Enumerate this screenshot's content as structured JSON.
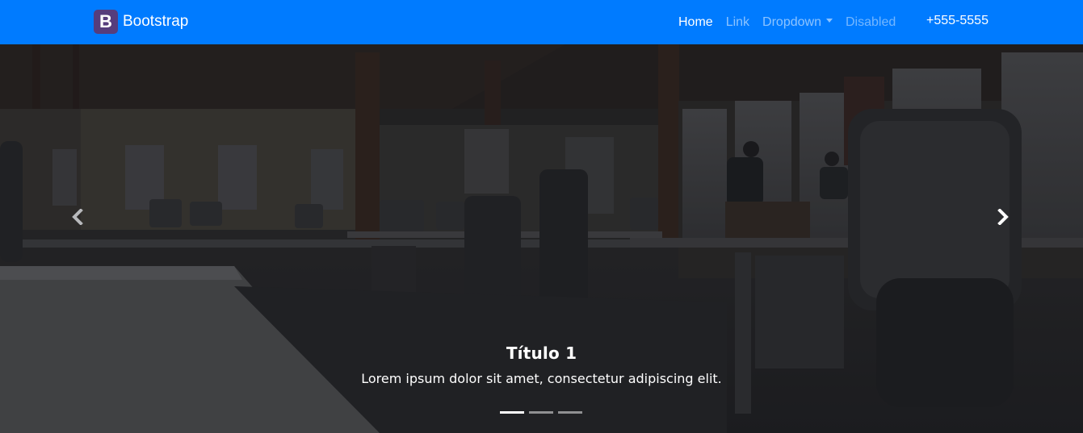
{
  "navbar": {
    "brand_logo_letter": "B",
    "brand_name": "Bootstrap",
    "links": [
      {
        "label": "Home",
        "state": "active"
      },
      {
        "label": "Link",
        "state": "normal"
      },
      {
        "label": "Dropdown",
        "state": "dropdown"
      },
      {
        "label": "Disabled",
        "state": "disabled"
      }
    ],
    "phone": "+555-5555",
    "colors": {
      "background": "#007bff",
      "brand_logo": "#563d7c"
    }
  },
  "carousel": {
    "caption_title": "Título 1",
    "caption_text": "Lorem ipsum dolor sit amet, consectetur adipiscing elit.",
    "indicators": 3,
    "active_index": 0,
    "prev_icon": "chevron-left-icon",
    "next_icon": "chevron-right-icon",
    "background": "dark office interior photo with desks and chairs"
  }
}
